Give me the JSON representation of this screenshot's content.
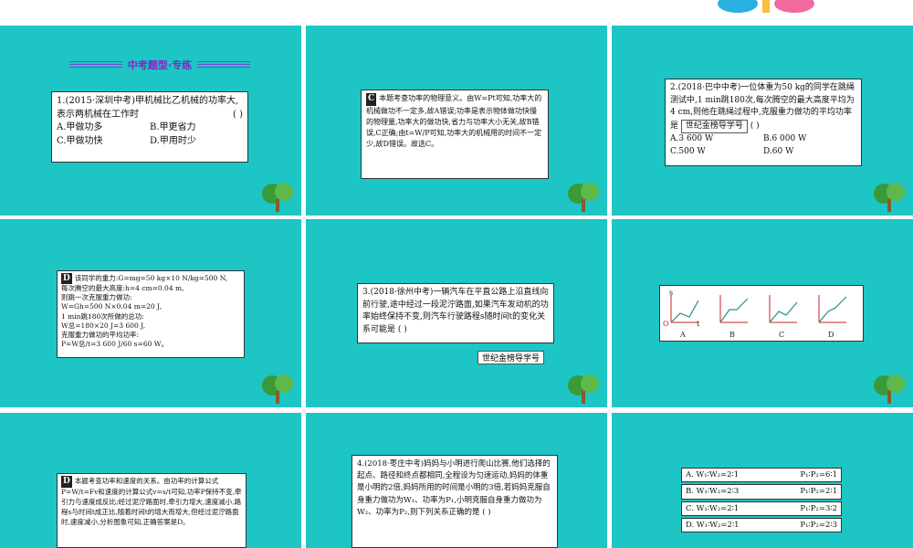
{
  "section_title": "中考题型·专练",
  "watermark": "世纪金榜导学号",
  "q1": {
    "stem": "1.(2015·深圳中考)甲机械比乙机械的功率大,表示两机械在工作时",
    "blank": "(      )",
    "options": [
      "A.甲做功多",
      "B.甲更省力",
      "C.甲做功快",
      "D.甲用时少"
    ]
  },
  "q1_solution": {
    "answer": "C",
    "text": "本题考查功率的物理意义。由W=Pt可知,功率大的机械做功不一定多,故A错误;功率是表示物体做功快慢的物理量,功率大的做功快,省力与功率大小无关,故B错误,C正确;由t=W/P可知,功率大的机械用的时间不一定少,故D错误。故选C。"
  },
  "q2": {
    "stem": "2.(2018·巴中中考)一位体重为50 kg的同学在跳绳测试中,1 min跳180次,每次腾空的最大高度平均为4 cm,则他在跳绳过程中,克服重力做功的平均功率是",
    "blank": "(      )",
    "options": [
      "A.3 600 W",
      "B.6 000 W",
      "C.500 W",
      "D.60 W"
    ]
  },
  "q2_solution": {
    "answer": "D",
    "lines": [
      "该同学的重力:G=mg=50 kg×10 N/kg=500 N,",
      "每次腾空的最大高度:h=4 cm=0.04 m,",
      "则跳一次克服重力做功:",
      "W=Gh=500 N×0.04 m=20 J,",
      "1 min跳180次所做的总功:",
      "W总=180×20 J=3 600 J,",
      "克服重力做功的平均功率:",
      "P=W总/t=3 600 J/60 s=60 W。"
    ]
  },
  "q3": {
    "stem": "3.(2018·徐州中考)一辆汽车在平直公路上沿直线向前行驶,途中经过一段泥泞路面,如果汽车发动机的功率始终保持不变,则汽车行驶路程s随时间t的变化关系可能是",
    "blank": "(      )",
    "graph_labels": [
      "A",
      "B",
      "C",
      "D"
    ],
    "axis_s": "s",
    "axis_t": "t",
    "origin": "O"
  },
  "q3_solution": {
    "answer": "D",
    "text": "本题考查功率和速度的关系。由功率的计算公式P=W/t=Fv和速度的计算公式v=s/t可知,功率P保持不变,牵引力与速度成反比;经过泥泞路面时,牵引力增大,速度减小,路程s与时间t成正比,随着时间t的增大而增大,但经过泥泞路面时,速度减小,分析图象可知,正确答案是D。"
  },
  "q4": {
    "stem": "4.(2018·枣庄中考)妈妈与小明进行爬山比赛,他们选择的起点、路径和终点都相同,全程设为匀速运动,妈妈的体重是小明的2倍,妈妈所用的时间是小明的3倍,若妈妈克服自身重力做功为W₁、功率为P₁,小明克服自身重力做功为W₂、功率为P₂,则下列关系正确的是",
    "blank": "(      )",
    "options": [
      [
        "A. W₁∶W₂=2∶1",
        "P₁∶P₂=6∶1"
      ],
      [
        "B. W₁∶W₂=2∶3",
        "P₁∶P₂=2∶1"
      ],
      [
        "C. W₁∶W₂=2∶1",
        "P₁∶P₂=3∶2"
      ],
      [
        "D. W₁∶W₂=2∶1",
        "P₁∶P₂=2∶3"
      ]
    ]
  }
}
